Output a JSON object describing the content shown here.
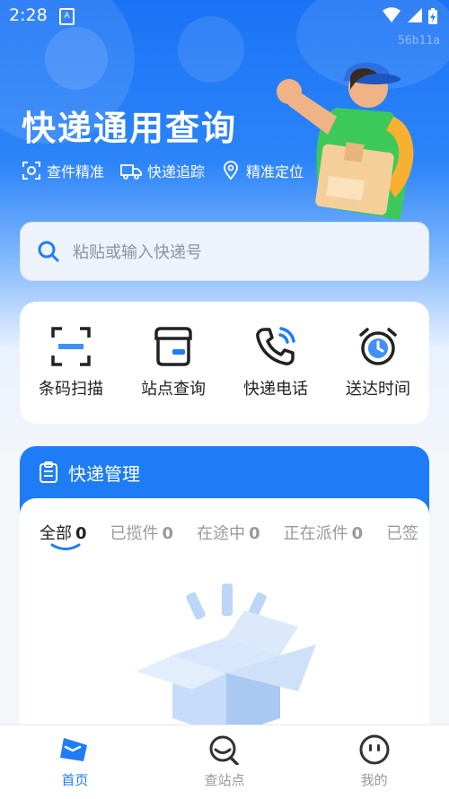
{
  "status": {
    "time": "2:28",
    "badge": "A"
  },
  "watermark": "56b11a",
  "header": {
    "title": "快递通用查询",
    "features": [
      {
        "icon": "scan-icon",
        "label": "查件精准"
      },
      {
        "icon": "truck-icon",
        "label": "快递追踪"
      },
      {
        "icon": "location-pin-icon",
        "label": "精准定位"
      }
    ]
  },
  "search": {
    "placeholder": "粘贴或输入快递号"
  },
  "quick_actions": [
    {
      "icon": "barcode-scan-icon",
      "label": "条码扫描"
    },
    {
      "icon": "store-icon",
      "label": "站点查询"
    },
    {
      "icon": "phone-call-icon",
      "label": "快递电话"
    },
    {
      "icon": "alarm-clock-icon",
      "label": "送达时间"
    }
  ],
  "management": {
    "title": "快递管理",
    "tabs": [
      {
        "label": "全部",
        "count": "0",
        "active": true
      },
      {
        "label": "已揽件",
        "count": "0",
        "active": false
      },
      {
        "label": "在途中",
        "count": "0",
        "active": false
      },
      {
        "label": "正在派件",
        "count": "0",
        "active": false
      },
      {
        "label": "已签",
        "count": "",
        "active": false
      }
    ]
  },
  "bottom_nav": [
    {
      "icon": "home-icon",
      "label": "首页",
      "active": true
    },
    {
      "icon": "search-station-icon",
      "label": "查站点",
      "active": false
    },
    {
      "icon": "smiley-icon",
      "label": "我的",
      "active": false
    }
  ],
  "colors": {
    "primary": "#1f7cf7",
    "text": "#222222",
    "muted": "#999999"
  }
}
